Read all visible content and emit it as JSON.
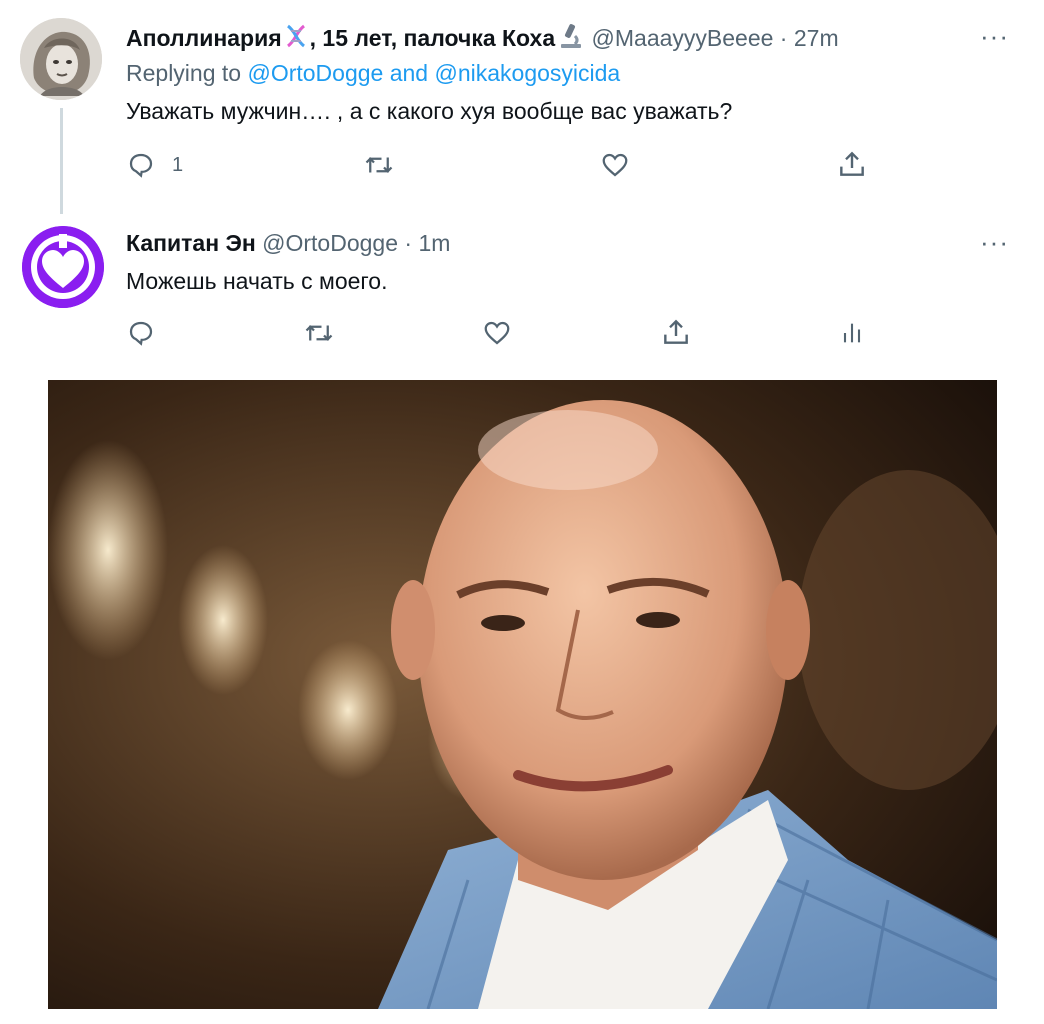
{
  "tweets": [
    {
      "author_name": "Аполлинария",
      "author_name_suffix": ", 15 лет, палочка Коха",
      "handle": "@MaaayyyBeeee",
      "separator": "·",
      "time": "27m",
      "replying_prefix": "Replying to",
      "replying_to_1": "@OrtoDogge",
      "replying_and": "and",
      "replying_to_2": "@nikakogosyicida",
      "text": "Уважать мужчин…. , а с какого хуя вообще вас уважать?",
      "reply_count": "1",
      "more_label": "···"
    },
    {
      "author_name": "Капитан Эн",
      "handle": "@OrtoDogge",
      "separator": "·",
      "time": "1m",
      "text": "Можешь начать с моего.",
      "more_label": "···"
    }
  ],
  "icons": {
    "reply": "reply-icon",
    "retweet": "retweet-icon",
    "like": "heart-icon",
    "share": "share-icon",
    "analytics": "analytics-icon",
    "dna": "dna-emoji",
    "microscope": "microscope-emoji"
  },
  "colors": {
    "link": "#1d9bf0",
    "muted": "#536471",
    "text": "#0f1419",
    "avatar_purple": "#8a1ef0"
  }
}
